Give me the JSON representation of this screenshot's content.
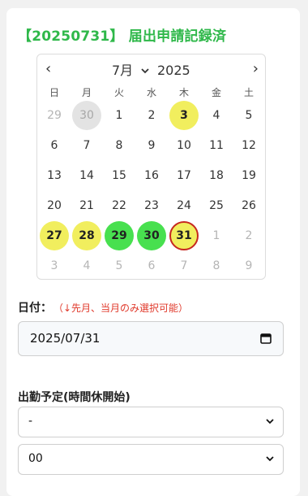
{
  "header": {
    "title": "【20250731】 届出申請記録済"
  },
  "calendar": {
    "prev": "‹",
    "next": "›",
    "month": "7月",
    "year": "2025",
    "weekdays": [
      "日",
      "月",
      "火",
      "水",
      "木",
      "金",
      "土"
    ],
    "weeks": [
      [
        "29",
        "30",
        "1",
        "2",
        "3",
        "4",
        "5"
      ],
      [
        "6",
        "7",
        "8",
        "9",
        "10",
        "11",
        "12"
      ],
      [
        "13",
        "14",
        "15",
        "16",
        "17",
        "18",
        "19"
      ],
      [
        "20",
        "21",
        "22",
        "23",
        "24",
        "25",
        "26"
      ],
      [
        "27",
        "28",
        "29",
        "30",
        "31",
        "1",
        "2"
      ],
      [
        "3",
        "4",
        "5",
        "6",
        "7",
        "8",
        "9"
      ]
    ],
    "colors": {
      "yellow": "#f1ee5e",
      "green": "#48e04f",
      "selected_border": "#c6281f",
      "today": "#e3e3e3"
    }
  },
  "date_field": {
    "label": "日付：",
    "note": "（↓先月、当月のみ選択可能）",
    "value": "2025/07/31"
  },
  "shift": {
    "label": "出勤予定(時間休開始)",
    "hour_value": "-",
    "minute_value": "00"
  },
  "colors": {
    "title_green": "#2fb84a",
    "note_red": "#e0392b"
  }
}
